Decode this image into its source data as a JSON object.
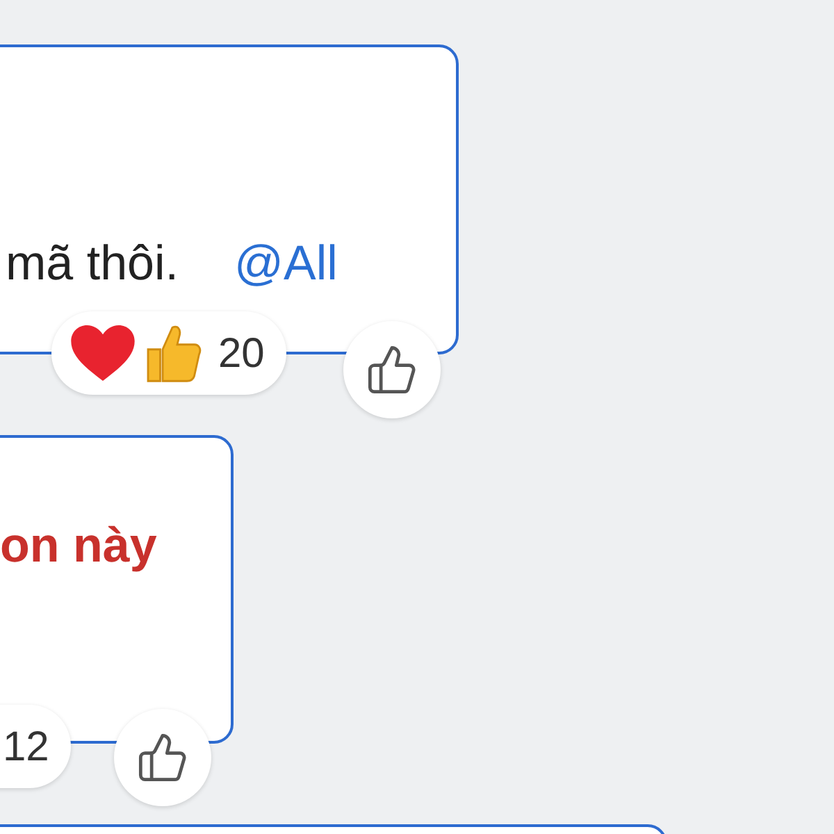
{
  "messages": [
    {
      "kind": "normal",
      "text": "mã thôi.",
      "mention": "@All",
      "reactions": [
        {
          "kind": "heart"
        },
        {
          "kind": "thumbs-up"
        }
      ],
      "count": "20"
    },
    {
      "kind": "alert",
      "text": "on này",
      "count": "12"
    }
  ]
}
